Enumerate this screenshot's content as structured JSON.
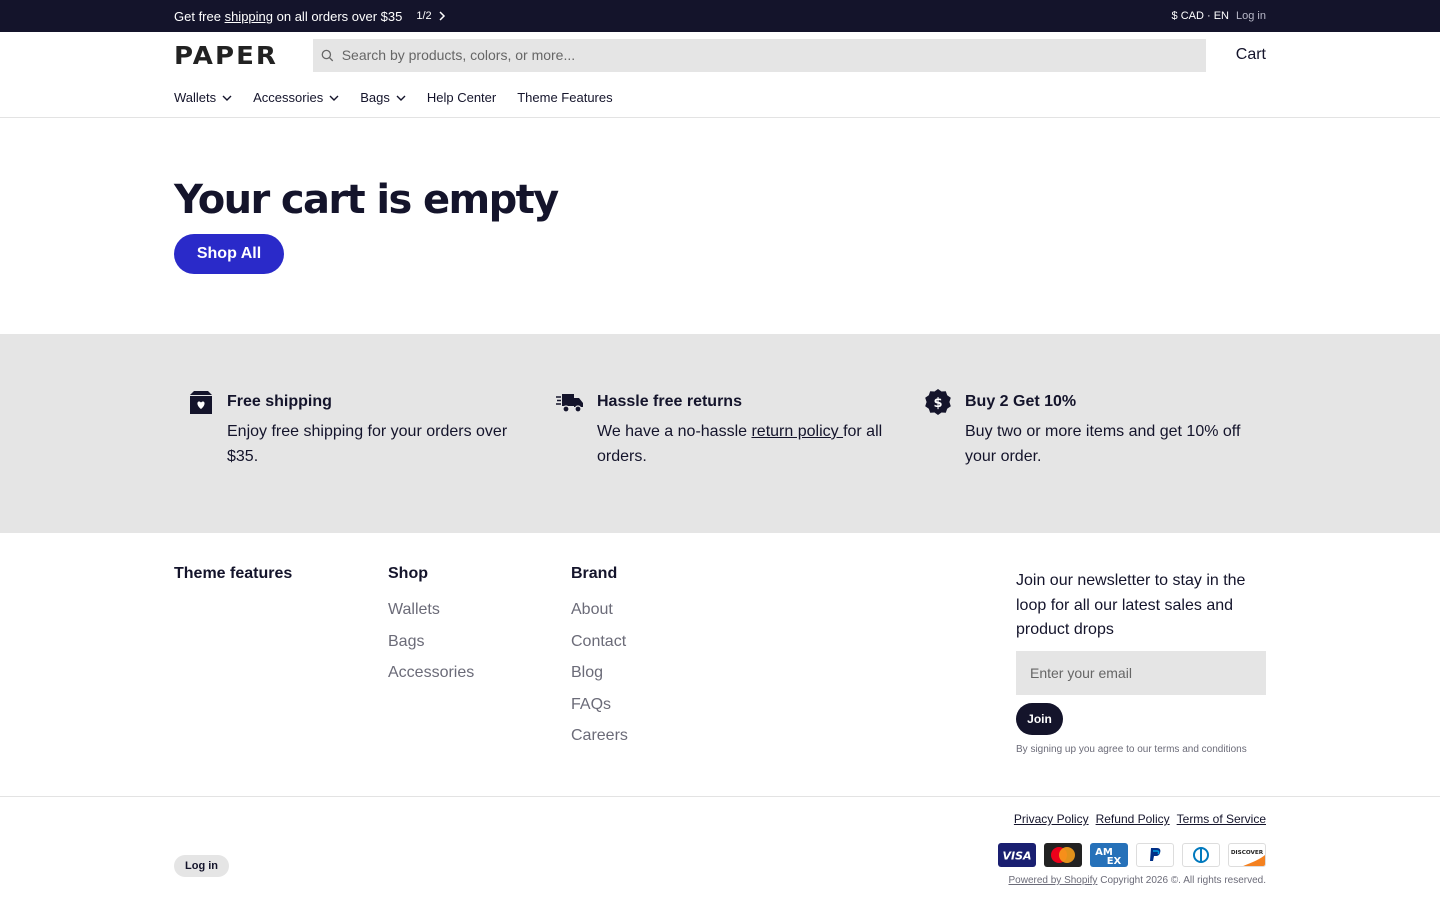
{
  "announcement": {
    "prefix": "Get free ",
    "link": "shipping",
    "suffix": " on all orders over $35",
    "counter": "1/2",
    "currency": "$ CAD · EN",
    "login": "Log in"
  },
  "header": {
    "logo": "PAPER",
    "search_placeholder": "Search by products, colors, or more...",
    "cart": "Cart"
  },
  "nav": {
    "items": [
      {
        "label": "Wallets",
        "dropdown": true
      },
      {
        "label": "Accessories",
        "dropdown": true
      },
      {
        "label": "Bags",
        "dropdown": true
      },
      {
        "label": "Help Center",
        "dropdown": false
      },
      {
        "label": "Theme Features",
        "dropdown": false
      }
    ]
  },
  "hero": {
    "title": "Your cart is empty",
    "button": "Shop All"
  },
  "features": [
    {
      "icon": "box-heart-icon",
      "title": "Free shipping",
      "text": "Enjoy free shipping for your orders over $35."
    },
    {
      "icon": "delivery-truck-icon",
      "title": "Hassle free returns",
      "text_pre": "We have a no-hassle ",
      "link": "return policy ",
      "text_post": "for all orders."
    },
    {
      "icon": "dollar-badge-icon",
      "title": "Buy 2 Get 10%",
      "text": "Buy two or more items and get 10% off your order."
    }
  ],
  "footer": {
    "theme_title": "Theme features",
    "shop": {
      "title": "Shop",
      "links": [
        "Wallets",
        "Bags",
        "Accessories"
      ]
    },
    "brand": {
      "title": "Brand",
      "links": [
        "About",
        "Contact",
        "Blog",
        "FAQs",
        "Careers"
      ]
    },
    "newsletter": {
      "lead": "Join our newsletter to stay in the loop for all our latest sales and product drops",
      "placeholder": "Enter your email",
      "button": "Join",
      "legal": "By signing up you agree to our terms and conditions"
    }
  },
  "bottom": {
    "login": "Log in",
    "policies": [
      "Privacy Policy",
      "Refund Policy",
      "Terms of Service"
    ],
    "payments": [
      {
        "name": "Visa",
        "bg": "#1a1f71"
      },
      {
        "name": "Mastercard",
        "bg": "#222222"
      },
      {
        "name": "American Express",
        "bg": "#2671b9"
      },
      {
        "name": "PayPal",
        "bg": "#ffffff"
      },
      {
        "name": "Diners Club",
        "bg": "#ffffff"
      },
      {
        "name": "Discover",
        "bg": "#ffffff"
      }
    ],
    "powered": "Powered by Shopify",
    "copyright": " Copyright 2026 ©. All rights reserved."
  },
  "colors": {
    "dark": "#14142b",
    "accent": "#2a2ac9",
    "band": "#e5e5e5",
    "muted": "#6b6b78"
  }
}
